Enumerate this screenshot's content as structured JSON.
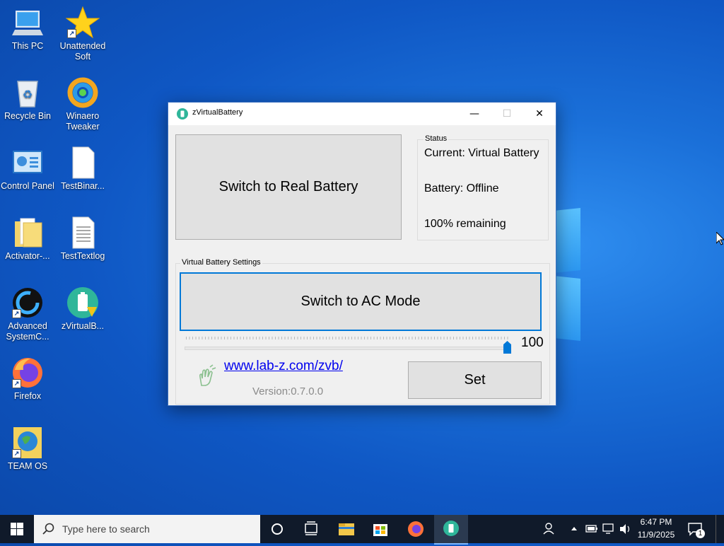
{
  "desktop": {
    "icons": [
      {
        "label": "This PC",
        "icon": "computer-icon"
      },
      {
        "label": "Unattended Soft",
        "icon": "star-icon"
      },
      {
        "label": "Recycle Bin",
        "icon": "recycle-bin-icon"
      },
      {
        "label": "Winaero Tweaker",
        "icon": "winaero-icon"
      },
      {
        "label": "Control Panel",
        "icon": "control-panel-icon"
      },
      {
        "label": "TestBinar...",
        "icon": "file-icon"
      },
      {
        "label": "Activator-...",
        "icon": "folder-icon"
      },
      {
        "label": "TestTextlog",
        "icon": "text-file-icon"
      },
      {
        "label": "Advanced SystemC...",
        "icon": "advanced-systemcare-icon"
      },
      {
        "label": "zVirtualB...",
        "icon": "zvirtualbattery-icon"
      },
      {
        "label": "Firefox",
        "icon": "firefox-icon"
      },
      {
        "label": "TEAM OS",
        "icon": "globe-icon"
      }
    ]
  },
  "window": {
    "title": "zVirtualBattery",
    "minimize": "—",
    "maximize": "☐",
    "close": "✕",
    "switch_real_label": "Switch to Real Battery",
    "status": {
      "legend": "Status",
      "current": "Current: Virtual Battery",
      "battery": "Battery: Offline",
      "remaining": "100% remaining"
    },
    "settings": {
      "legend": "Virtual Battery Settings",
      "switch_ac_label": "Switch to AC Mode",
      "slider_value": 100,
      "slider_value_label": "100",
      "link": "www.lab-z.com/zvb/",
      "version": "Version:0.7.0.0",
      "set_label": "Set"
    }
  },
  "taskbar": {
    "search_placeholder": "Type here to search",
    "time": "6:47 PM",
    "date": "11/9/2025",
    "notification_count": "1",
    "pinned": [
      "cortana-icon",
      "task-view-icon",
      "file-explorer-icon",
      "store-icon",
      "firefox-icon",
      "zvirtualbattery-icon"
    ],
    "colors": {
      "accent": "#0078d7",
      "taskbar": "#101a2a"
    }
  }
}
